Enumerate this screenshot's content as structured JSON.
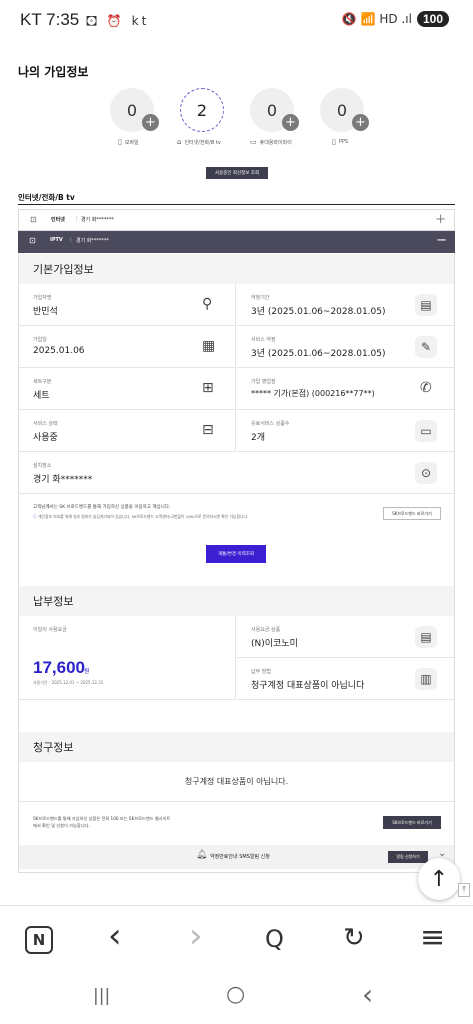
{
  "status_bar": {
    "time": "KT 7:35",
    "left_icons": "🖸 ⏰ kt",
    "signal_icons": "🔇 📶 HD .ıl",
    "battery": "100"
  },
  "my_subscription": {
    "title": "나의 가입정보",
    "services": [
      {
        "count": "0",
        "label": "모바일",
        "icon": "mobile-icon"
      },
      {
        "count": "2",
        "label": "인터넷/전화/B tv",
        "icon": "home-icon"
      },
      {
        "count": "0",
        "label": "휴대용와이파이",
        "icon": "wifi-device-icon"
      },
      {
        "count": "0",
        "label": "PPS",
        "icon": "pps-icon"
      }
    ],
    "button_label": "사용중인 회선정보 조회"
  },
  "internet_section": {
    "title": "인터넷/전화/B tv",
    "rows": [
      {
        "type": "인터넷",
        "address": "경기 화*******",
        "toggle": "+"
      },
      {
        "type": "IPTV",
        "address": "경기 화*******",
        "toggle": "−"
      }
    ]
  },
  "basic_info": {
    "title": "기본가입정보",
    "fields": [
      {
        "label": "가입자명",
        "value": "반민석",
        "icon": "person-icon"
      },
      {
        "label": "약정기간",
        "value": "3년 (2025.01.06~2028.01.05)",
        "icon": "document-search-icon"
      },
      {
        "label": "가입일",
        "value": "2025.01.06",
        "icon": "calendar-icon"
      },
      {
        "label": "서비스 약정",
        "value": "3년 (2025.01.06~2028.01.05)",
        "icon": "edit-document-icon"
      },
      {
        "label": "세트구분",
        "value": "세트",
        "icon": "gift-icon"
      },
      {
        "label": "가입 영업점",
        "value": "***** 기가(본점) (000216**77**)",
        "icon": "phone-icon"
      },
      {
        "label": "서비스 상태",
        "value": "사용중",
        "icon": "chat-icon"
      },
      {
        "label": "유료서비스 상품수",
        "value": "2개",
        "icon": "tv-icon"
      },
      {
        "label": "설치장소",
        "value": "경기 화*******",
        "icon": "location-icon"
      }
    ],
    "notice_line1": "고객님께서는 SK 브로드밴드를 통해 가입하신 상품을 이용하고 계십니다.",
    "notice_line2": "개인정보 보호를 위해 일부 정보가 숨김처리되어 있습니다. SK브로드밴드 고객센터(국번없이 106)으로 문의하시면 확인 가능합니다.",
    "sk_button": "SK브로드밴드 바로가기",
    "history_button": "개통/변경 이력조회"
  },
  "payment_info": {
    "title": "납부정보",
    "monthly_label": "이달의 사용요금",
    "amount": "17,600",
    "unit": "원",
    "period": "사용기간 : 2025.12.01 ~ 2025.12.31",
    "plan_label": "사용요금 상품",
    "plan_value": "(N)이코노미",
    "payment_label": "납부 방법",
    "payment_value": "청구계정 대표상품이 아닙니다"
  },
  "billing_info": {
    "title": "청구정보",
    "message": "청구계정 대표상품이 아닙니다.",
    "bottom_note_1": "SK브로드밴드를 통해 가입하신 상품은 전화 106 또는 SK브로드밴드 웹사이트",
    "bottom_note_2": "에서 확인 및 신청이 가능합니다.",
    "bottom_button": "SK브로드밴드 바로가기",
    "sms_label": "약정만료안내 SMS알림 신청",
    "sms_button": "알림 신청하기"
  },
  "browser_nav": {
    "home": "N",
    "back": "‹",
    "forward": "›",
    "search": "Q",
    "refresh": "↻",
    "menu": "≡"
  },
  "system_nav": {
    "recent": "|||",
    "home": "○",
    "back": "‹"
  },
  "colors": {
    "accent_purple": "#3b1fd1",
    "dark_header": "#4b4a5c",
    "amount_blue": "#2b22c9"
  }
}
